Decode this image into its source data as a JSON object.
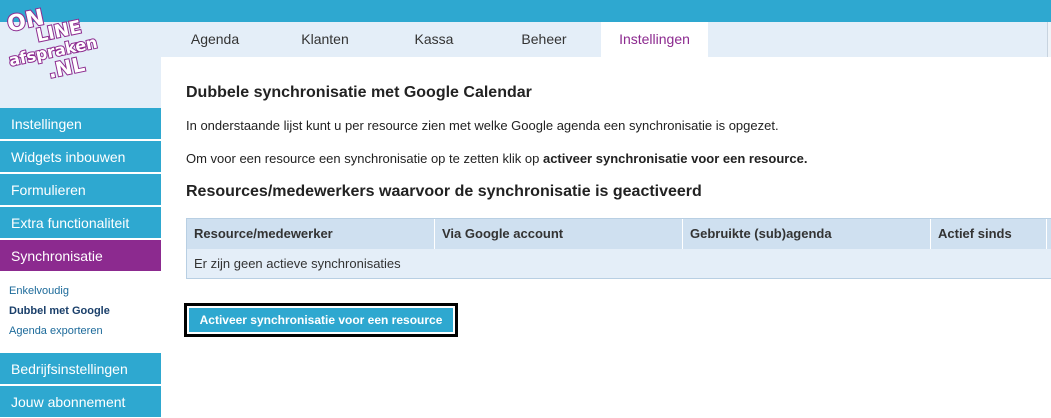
{
  "logo": {
    "line1": "ON",
    "line2": "LINE",
    "line3": "afspraken",
    "line4": ".NL"
  },
  "top_tabs": [
    {
      "label": "Agenda"
    },
    {
      "label": "Klanten"
    },
    {
      "label": "Kassa"
    },
    {
      "label": "Beheer"
    },
    {
      "label": "Instellingen",
      "active": true
    }
  ],
  "sidebar": {
    "items": [
      {
        "label": "Instellingen"
      },
      {
        "label": "Widgets inbouwen"
      },
      {
        "label": "Formulieren"
      },
      {
        "label": "Extra functionaliteit"
      },
      {
        "label": "Synchronisatie",
        "active": true
      },
      {
        "label": "Bedrijfsinstellingen"
      },
      {
        "label": "Jouw abonnement"
      }
    ],
    "subitems": [
      {
        "label": "Enkelvoudig"
      },
      {
        "label": "Dubbel met Google",
        "active": true
      },
      {
        "label": "Agenda exporteren"
      }
    ]
  },
  "main": {
    "title": "Dubbele synchronisatie met Google Calendar",
    "intro": "In onderstaande lijst kunt u per resource zien met welke Google agenda een synchronisatie is opgezet.",
    "instruction_prefix": "Om voor een resource een synchronisatie op te zetten klik op ",
    "instruction_bold": "activeer synchronisatie voor een resource.",
    "section_title": "Resources/medewerkers waarvoor de synchronisatie is geactiveerd",
    "table": {
      "columns": [
        "Resource/medewerker",
        "Via Google account",
        "Gebruikte (sub)agenda",
        "Actief sinds"
      ],
      "empty_message": "Er zijn geen actieve synchronisaties"
    },
    "activate_button": "Activeer synchronisatie voor een resource"
  },
  "colors": {
    "primary_blue": "#2ea8d0",
    "active_purple": "#8c2a8f",
    "light_panel": "#e4eef8",
    "table_header": "#cfe0f0"
  }
}
